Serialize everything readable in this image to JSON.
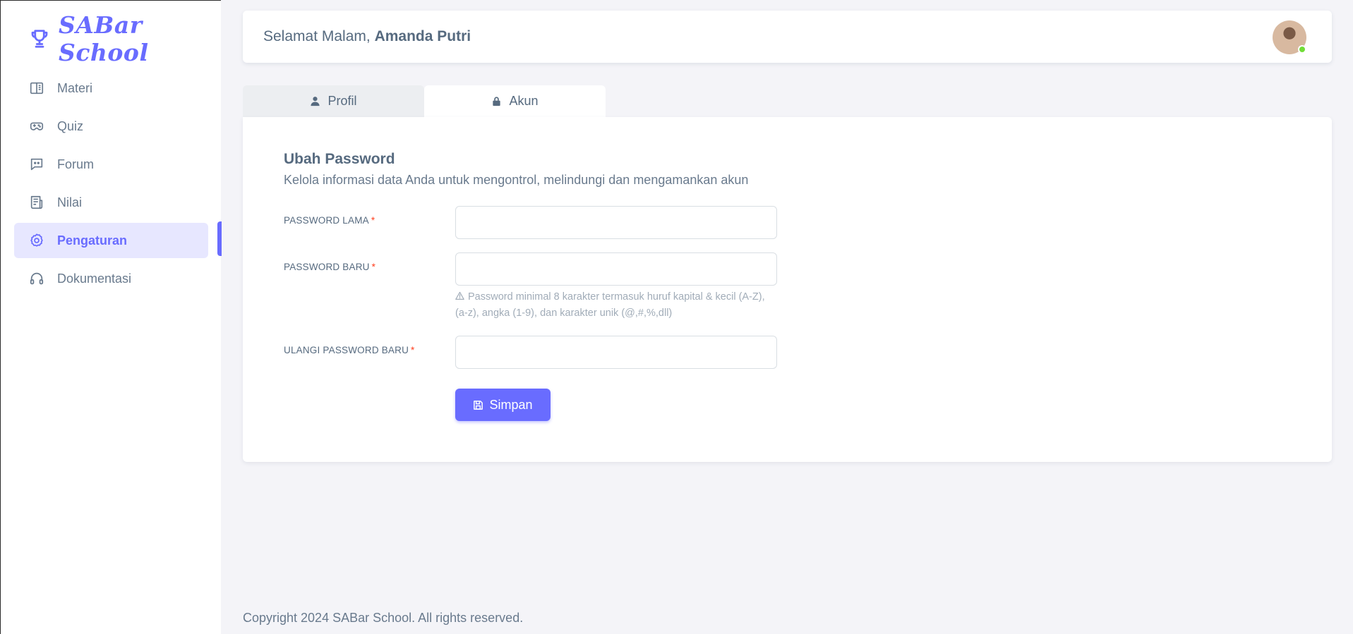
{
  "brand": {
    "name": "SABar School",
    "color": "#696cff"
  },
  "sidebar": {
    "items": [
      {
        "label": "Materi",
        "icon": "book-open-icon",
        "active": false
      },
      {
        "label": "Quiz",
        "icon": "gamepad-icon",
        "active": false
      },
      {
        "label": "Forum",
        "icon": "chat-icon",
        "active": false
      },
      {
        "label": "Nilai",
        "icon": "receipt-icon",
        "active": false
      },
      {
        "label": "Pengaturan",
        "icon": "cog-icon",
        "active": true
      },
      {
        "label": "Dokumentasi",
        "icon": "headphones-icon",
        "active": false
      }
    ]
  },
  "header": {
    "greeting": "Selamat Malam,",
    "user_name": "Amanda Putri",
    "avatar_status": "online"
  },
  "tabs": [
    {
      "label": "Profil",
      "icon": "user-icon",
      "active": false
    },
    {
      "label": "Akun",
      "icon": "lock-icon",
      "active": true
    }
  ],
  "form": {
    "title": "Ubah Password",
    "subtitle": "Kelola informasi data Anda untuk mengontrol, melindungi dan mengamankan akun",
    "fields": [
      {
        "label": "PASSWORD LAMA",
        "required_mark": "*",
        "value": ""
      },
      {
        "label": "PASSWORD BARU",
        "required_mark": "*",
        "value": ""
      },
      {
        "label": "ULANGI PASSWORD BARU",
        "required_mark": "*",
        "value": ""
      }
    ],
    "hint": "Password minimal 8 karakter termasuk huruf kapital & kecil (A-Z), (a-z), angka (1-9), dan karakter unik (@,#,%,dll)",
    "submit_label": "Simpan"
  },
  "footer": {
    "text": "Copyright 2024 SABar School. All rights reserved."
  }
}
